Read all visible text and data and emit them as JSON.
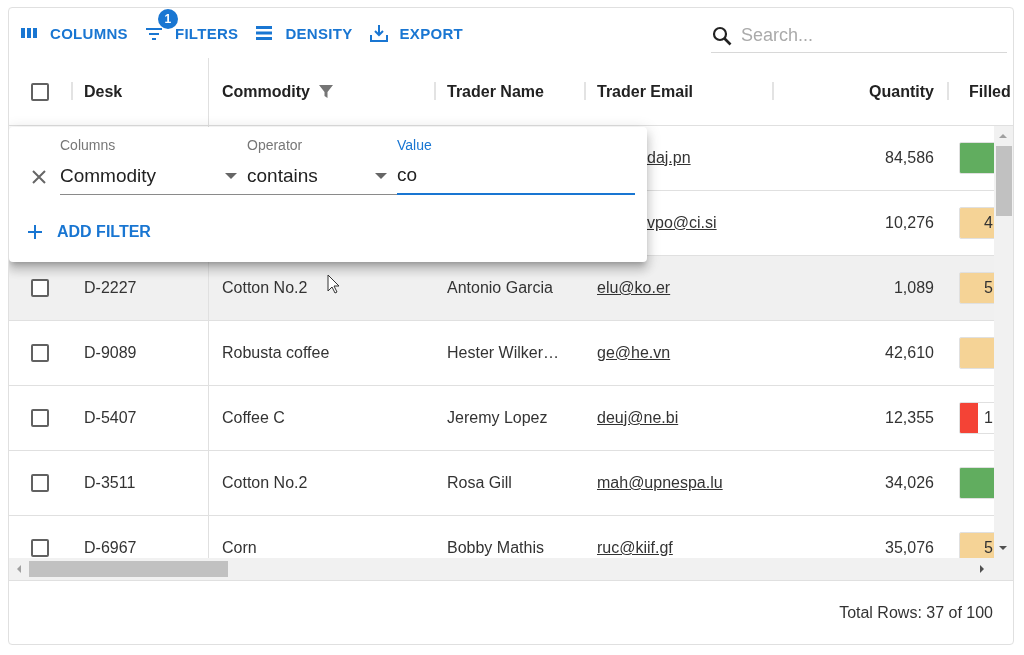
{
  "toolbar": {
    "buttons": [
      {
        "kind": "columns",
        "label": "COLUMNS"
      },
      {
        "kind": "filters",
        "label": "FILTERS",
        "badge": "1"
      },
      {
        "kind": "density",
        "label": "DENSITY"
      },
      {
        "kind": "export",
        "label": "EXPORT"
      }
    ],
    "search": {
      "placeholder": "Search..."
    }
  },
  "table": {
    "header_checkbox": {
      "checked": false
    },
    "columns": [
      {
        "label": "Desk",
        "filtered": false
      },
      {
        "label": "Commodity",
        "filtered": true
      },
      {
        "label": "Trader Name",
        "filtered": false
      },
      {
        "label": "Trader Email",
        "filtered": false
      },
      {
        "label": "Quantity",
        "filtered": false
      },
      {
        "label": "Filled",
        "filtered": false
      }
    ],
    "rows": [
      {
        "kind": "under-panel",
        "email": "daj.pn",
        "quantity": "84,586",
        "filled": {
          "level": 0.85,
          "color": "#61ad5f"
        }
      },
      {
        "kind": "under-panel",
        "email": "vpo@ci.si",
        "quantity": "10,276",
        "filled": {
          "level": 0.45,
          "color": "#f5d396",
          "text": "4"
        }
      },
      {
        "kind": "full",
        "checked": false,
        "highlighted": true,
        "desk": "D-2227",
        "commodity": "Cotton No.2",
        "trader_name": "Antonio Garcia",
        "email": "elu@ko.er",
        "quantity": "1,089",
        "filled": {
          "level": 0.55,
          "color": "#f5d396",
          "text": "5"
        }
      },
      {
        "kind": "full",
        "checked": false,
        "highlighted": false,
        "desk": "D-9089",
        "commodity": "Robusta coffee",
        "trader_name": "Hester Wilker…",
        "email": "ge@he.vn",
        "quantity": "42,610",
        "filled": {
          "level": 0.55,
          "color": "#f5d396"
        }
      },
      {
        "kind": "full",
        "checked": false,
        "highlighted": false,
        "desk": "D-5407",
        "commodity": "Coffee C",
        "trader_name": "Jeremy Lopez",
        "email": "deuj@ne.bi",
        "quantity": "12,355",
        "filled": {
          "level": 0.17,
          "color": "#f44336",
          "text": "1"
        }
      },
      {
        "kind": "full",
        "checked": false,
        "highlighted": false,
        "desk": "D-3511",
        "commodity": "Cotton No.2",
        "trader_name": "Rosa Gill",
        "email": "mah@upnespa.lu",
        "quantity": "34,026",
        "filled": {
          "level": 0.65,
          "color": "#61ad5f"
        }
      },
      {
        "kind": "full",
        "checked": false,
        "highlighted": false,
        "desk": "D-6967",
        "commodity": "Corn",
        "trader_name": "Bobby Mathis",
        "email": "ruc@kiif.gf",
        "quantity": "35,076",
        "filled": {
          "level": 0.55,
          "color": "#f5d396",
          "text": "5"
        }
      }
    ]
  },
  "filter_panel": {
    "filters": [
      {
        "column_label": "Columns",
        "column": "Commodity",
        "operator_label": "Operator",
        "operator": "contains",
        "value_label": "Value",
        "value": "co",
        "focused": true
      }
    ],
    "add_button": "ADD FILTER"
  },
  "footer": {
    "total": "Total Rows: 37 of 100"
  }
}
